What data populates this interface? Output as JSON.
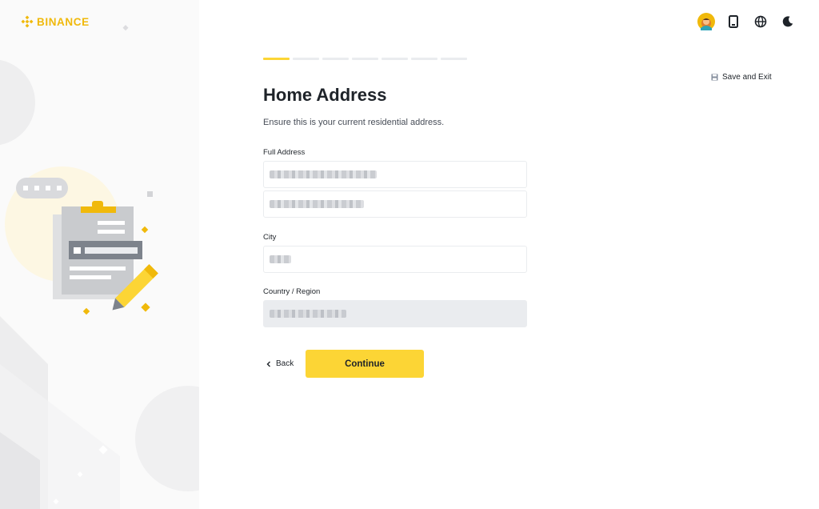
{
  "brand": {
    "name": "BINANCE",
    "color": "#F0B90B"
  },
  "header": {
    "icons": [
      "avatar",
      "phone-icon",
      "globe-icon",
      "moon-icon"
    ]
  },
  "progress": {
    "total_steps": 7,
    "current_step": 1
  },
  "save_exit": {
    "label": "Save and Exit",
    "icon": "save-icon"
  },
  "form": {
    "title": "Home Address",
    "subtitle": "Ensure this is your current residential address.",
    "full_address": {
      "label": "Full Address",
      "line1_value": "",
      "line2_value": ""
    },
    "city": {
      "label": "City",
      "value": ""
    },
    "country": {
      "label": "Country / Region",
      "value": "",
      "disabled": true
    }
  },
  "actions": {
    "back_label": "Back",
    "continue_label": "Continue"
  },
  "colors": {
    "accent": "#FCD535",
    "brand": "#F0B90B",
    "text": "#1E2329",
    "muted": "#474D57",
    "border": "#EAECEF"
  }
}
